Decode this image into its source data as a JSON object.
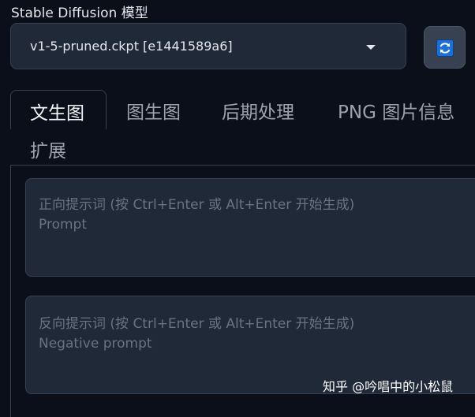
{
  "model": {
    "label": "Stable Diffusion 模型",
    "selected": "v1-5-pruned.ckpt [e1441589a6]",
    "refresh_icon": "refresh-icon"
  },
  "tabs": [
    {
      "label": "文生图",
      "active": true
    },
    {
      "label": "图生图",
      "active": false
    },
    {
      "label": "后期处理",
      "active": false
    },
    {
      "label": "PNG 图片信息",
      "active": false
    },
    {
      "label": "扩展",
      "active": false
    }
  ],
  "prompt": {
    "placeholder_line1": "正向提示词 (按 Ctrl+Enter 或 Alt+Enter 开始生成)",
    "placeholder_line2": "Prompt"
  },
  "negative_prompt": {
    "placeholder_line1": "反向提示词 (按 Ctrl+Enter 或 Alt+Enter 开始生成)",
    "placeholder_line2": "Negative prompt"
  },
  "watermark": "知乎 @吟唱中的小松鼠",
  "colors": {
    "background": "#0b0f19",
    "input_bg": "#1f2937",
    "border": "#374151",
    "accent": "#1d6fd8"
  }
}
